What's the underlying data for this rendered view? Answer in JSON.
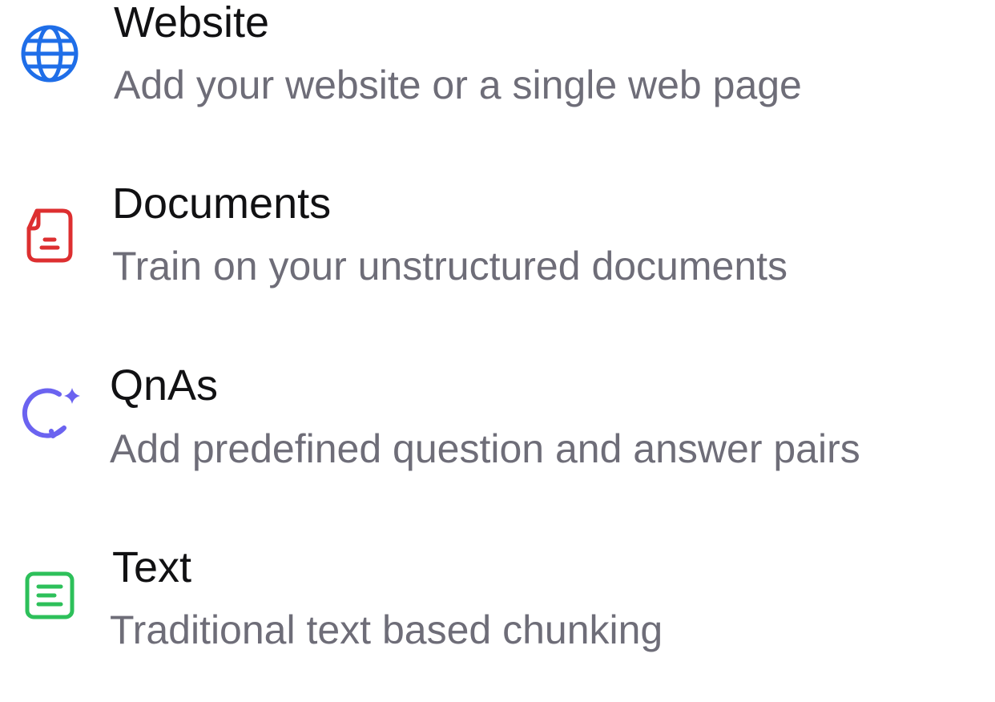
{
  "options": [
    {
      "title": "Website",
      "description": "Add your website or a single web page",
      "icon": "globe-icon",
      "icon_color": "#1f6ee8"
    },
    {
      "title": "Documents",
      "description": "Train on your unstructured documents",
      "icon": "document-icon",
      "icon_color": "#dd2f30"
    },
    {
      "title": "QnAs",
      "description": "Add predefined question and answer pairs",
      "icon": "chat-sparkle-icon",
      "icon_color": "#6b63f0"
    },
    {
      "title": "Text",
      "description": "Traditional text based chunking",
      "icon": "text-lines-icon",
      "icon_color": "#2dc05a"
    }
  ]
}
